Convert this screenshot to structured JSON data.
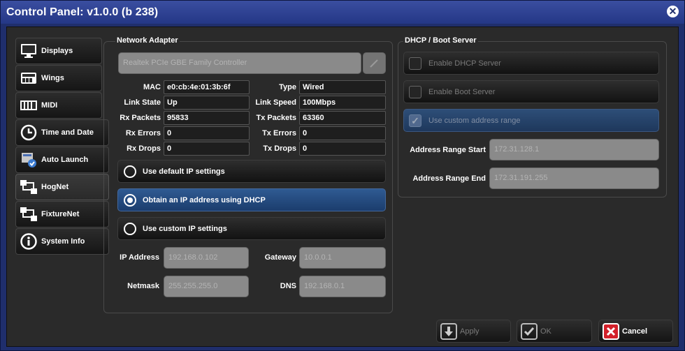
{
  "window": {
    "title": "Control Panel: v1.0.0 (b 238)"
  },
  "sidebar": {
    "items": [
      {
        "label": "Displays",
        "icon": "monitor-icon"
      },
      {
        "label": "Wings",
        "icon": "wing-keyboard-icon"
      },
      {
        "label": "MIDI",
        "icon": "midi-icon"
      },
      {
        "label": "Time and Date",
        "icon": "clock-icon"
      },
      {
        "label": "Auto Launch",
        "icon": "auto-launch-icon"
      },
      {
        "label": "HogNet",
        "icon": "network-icon",
        "active": true
      },
      {
        "label": "FixtureNet",
        "icon": "network-icon"
      },
      {
        "label": "System Info",
        "icon": "info-icon"
      }
    ]
  },
  "network": {
    "legend": "Network Adapter",
    "adapter": "Realtek PCIe GBE Family Controller",
    "rows": [
      {
        "l1": "MAC",
        "v1": "e0:cb:4e:01:3b:6f",
        "l2": "Type",
        "v2": "Wired"
      },
      {
        "l1": "Link State",
        "v1": "Up",
        "l2": "Link Speed",
        "v2": "100Mbps"
      },
      {
        "l1": "Rx Packets",
        "v1": "95833",
        "l2": "Tx Packets",
        "v2": "63360"
      },
      {
        "l1": "Rx Errors",
        "v1": "0",
        "l2": "Tx Errors",
        "v2": "0"
      },
      {
        "l1": "Rx Drops",
        "v1": "0",
        "l2": "Tx Drops",
        "v2": "0"
      }
    ],
    "options": {
      "default_ip": "Use default IP settings",
      "dhcp": "Obtain an IP address using DHCP",
      "custom": "Use custom IP settings"
    },
    "ip": {
      "ip_label": "IP Address",
      "ip_value": "192.168.0.102",
      "gateway_label": "Gateway",
      "gateway_value": "10.0.0.1",
      "netmask_label": "Netmask",
      "netmask_value": "255.255.255.0",
      "dns_label": "DNS",
      "dns_value": "192.168.0.1"
    }
  },
  "dhcp": {
    "legend": "DHCP / Boot Server",
    "enable_dhcp": "Enable DHCP Server",
    "enable_boot": "Enable Boot Server",
    "custom_range": "Use custom address range",
    "range_start_label": "Address Range Start",
    "range_start": "172.31.128.1",
    "range_end_label": "Address Range End",
    "range_end": "172.31.191.255"
  },
  "footer": {
    "apply": "Apply",
    "ok": "OK",
    "cancel": "Cancel"
  },
  "colors": {
    "accent": "#2f5a92",
    "title_bg": "#243786",
    "cancel_red": "#d3202a"
  }
}
